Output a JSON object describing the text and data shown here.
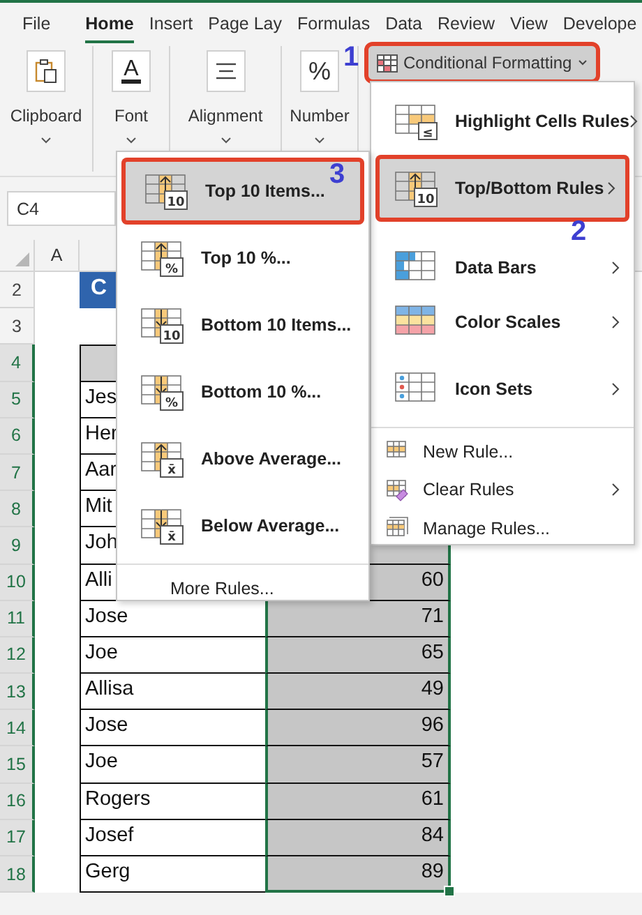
{
  "ribbon_tabs": [
    {
      "label": "File",
      "selected": false
    },
    {
      "label": "Home",
      "selected": true
    },
    {
      "label": "Insert",
      "selected": false
    },
    {
      "label": "Page Lay",
      "selected": false
    },
    {
      "label": "Formulas",
      "selected": false
    },
    {
      "label": "Data",
      "selected": false
    },
    {
      "label": "Review",
      "selected": false
    },
    {
      "label": "View",
      "selected": false
    },
    {
      "label": "Develope",
      "selected": false
    }
  ],
  "ribbon_groups": [
    {
      "label": "Clipboard",
      "kind": "clipboard"
    },
    {
      "label": "Font",
      "kind": "font",
      "icon_text": "A"
    },
    {
      "label": "Alignment",
      "kind": "alignment"
    },
    {
      "label": "Number",
      "kind": "number",
      "icon_text": "%"
    }
  ],
  "conditional_formatting_button": {
    "label": "Conditional Formatting",
    "pressed": true,
    "highlighted": true
  },
  "name_box": {
    "value": "C4"
  },
  "sheet": {
    "columns": [
      {
        "label": "A"
      }
    ],
    "rows": [
      {
        "number": "2",
        "selected": false,
        "kind": "title",
        "title": "C"
      },
      {
        "number": "3",
        "selected": false,
        "kind": "blank"
      },
      {
        "number": "4",
        "selected": true,
        "kind": "header"
      },
      {
        "number": "5",
        "selected": true,
        "kind": "data",
        "name": "Jes"
      },
      {
        "number": "6",
        "selected": true,
        "kind": "data",
        "name": "Her"
      },
      {
        "number": "7",
        "selected": true,
        "kind": "data",
        "name": "Aar"
      },
      {
        "number": "8",
        "selected": true,
        "kind": "data",
        "name": "Mit"
      },
      {
        "number": "9",
        "selected": true,
        "kind": "data",
        "name": "Joh"
      },
      {
        "number": "10",
        "selected": true,
        "kind": "data",
        "name": "Alli",
        "value": "60"
      },
      {
        "number": "11",
        "selected": true,
        "kind": "data",
        "name": "Jose",
        "value": "71"
      },
      {
        "number": "12",
        "selected": true,
        "kind": "data",
        "name": "Joe",
        "value": "65"
      },
      {
        "number": "13",
        "selected": true,
        "kind": "data",
        "name": "Allisa",
        "value": "49"
      },
      {
        "number": "14",
        "selected": true,
        "kind": "data",
        "name": "Jose",
        "value": "96"
      },
      {
        "number": "15",
        "selected": true,
        "kind": "data",
        "name": "Joe",
        "value": "57"
      },
      {
        "number": "16",
        "selected": true,
        "kind": "data",
        "name": "Rogers",
        "value": "61"
      },
      {
        "number": "17",
        "selected": true,
        "kind": "data",
        "name": "Josef",
        "value": "84"
      },
      {
        "number": "18",
        "selected": true,
        "kind": "data",
        "name": "Gerg",
        "value": "89"
      }
    ]
  },
  "conditional_formatting_menu": {
    "items": [
      {
        "label": "Highlight Cells Rules",
        "kind": "highlight",
        "icon_text": "≤",
        "submenu": true,
        "selected": false,
        "highlighted": false
      },
      {
        "label": "Top/Bottom Rules",
        "kind": "top",
        "icon_text": "10",
        "submenu": true,
        "selected": true,
        "highlighted": true
      },
      {
        "label": "Data Bars",
        "kind": "databars",
        "submenu": true,
        "selected": false,
        "highlighted": false
      },
      {
        "label": "Color Scales",
        "kind": "colorscales",
        "submenu": true,
        "selected": false,
        "highlighted": false
      },
      {
        "label": "Icon Sets",
        "kind": "iconsets",
        "submenu": true,
        "selected": false,
        "highlighted": false
      }
    ],
    "small_items": [
      {
        "label": "New Rule...",
        "kind": "newrule",
        "submenu": false
      },
      {
        "label": "Clear Rules",
        "kind": "clearrules",
        "submenu": true
      },
      {
        "label": "Manage Rules...",
        "kind": "managerules",
        "submenu": false
      }
    ]
  },
  "top_bottom_menu": {
    "items": [
      {
        "label": "Top 10 Items...",
        "kind": "top",
        "icon_text": "10",
        "selected": true,
        "highlighted": true
      },
      {
        "label": "Top 10 %...",
        "kind": "top",
        "icon_text": "%",
        "selected": false,
        "highlighted": false
      },
      {
        "label": "Bottom 10 Items...",
        "kind": "bottom",
        "icon_text": "10",
        "selected": false,
        "highlighted": false
      },
      {
        "label": "Bottom 10 %...",
        "kind": "bottom",
        "icon_text": "%",
        "selected": false,
        "highlighted": false
      },
      {
        "label": "Above Average...",
        "kind": "top",
        "icon_text": "x̄",
        "selected": false,
        "highlighted": false
      },
      {
        "label": "Below Average...",
        "kind": "bottom",
        "icon_text": "x̄",
        "selected": false,
        "highlighted": false
      }
    ],
    "footer": "More Rules..."
  },
  "step_labels": [
    "1",
    "2",
    "3"
  ]
}
